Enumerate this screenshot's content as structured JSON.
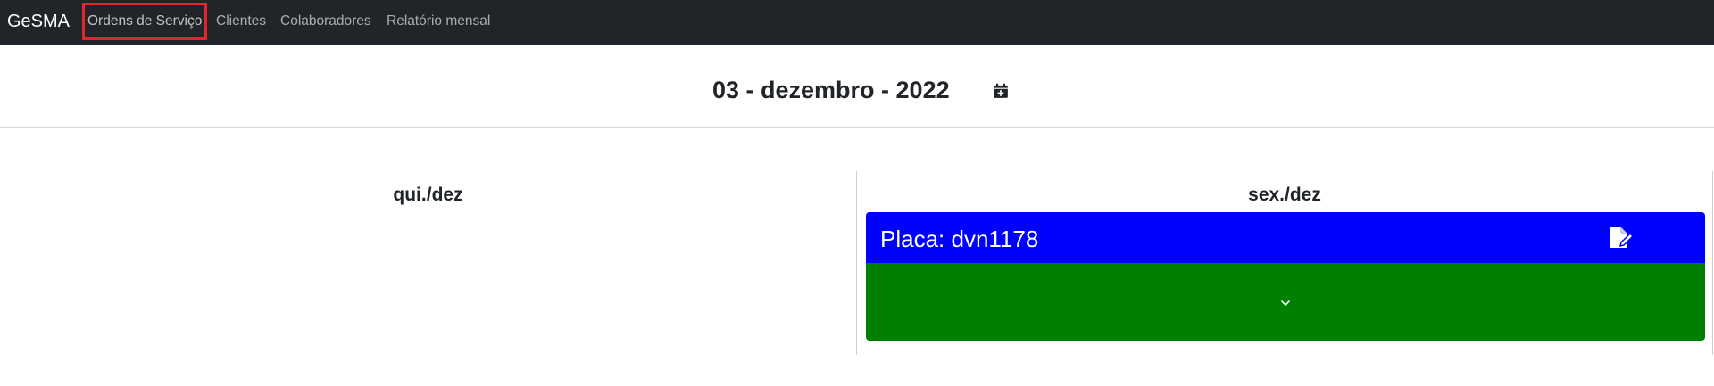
{
  "navbar": {
    "brand": "GeSMA",
    "links": [
      {
        "label": "Ordens de Serviço",
        "active": true
      },
      {
        "label": "Clientes",
        "active": false
      },
      {
        "label": "Colaboradores",
        "active": false
      },
      {
        "label": "Relatório mensal",
        "active": false
      }
    ],
    "highlight_color": "#e3262b"
  },
  "date_header": {
    "title": "03 - dezembro - 2022",
    "calendar_icon": "calendar-plus-icon"
  },
  "columns": [
    {
      "day_label": "qui./dez",
      "cards": []
    },
    {
      "day_label": "sex./dez",
      "cards": [
        {
          "title": "Placa: dvn1178",
          "header_color": "#0000ff",
          "body_color": "#008000",
          "edit_icon": "file-edit-icon",
          "expand_icon": "chevron-down-icon"
        }
      ]
    }
  ],
  "colors": {
    "navbar_bg": "#212529",
    "card_header": "#0000ff",
    "card_body": "#008000"
  }
}
